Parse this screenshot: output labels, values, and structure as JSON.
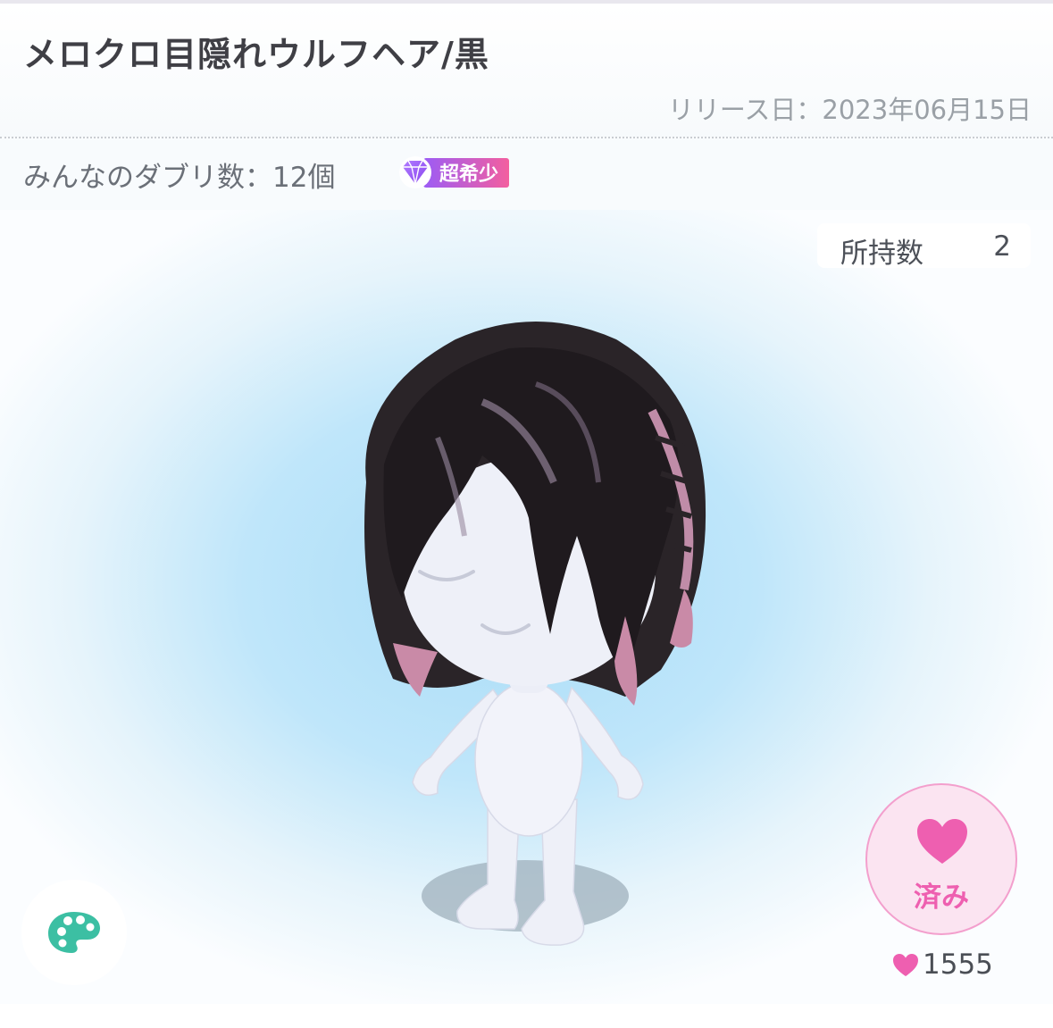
{
  "item": {
    "title": "メロクロ目隠れウルフヘア/黒",
    "release": "リリース日：2023年06月15日"
  },
  "stats": {
    "duplicates": "みんなのダブリ数：12個",
    "rarity_icon": "diamond-icon",
    "rarity_label": "超希少"
  },
  "owned": {
    "label": "所持数",
    "value": "2"
  },
  "actions": {
    "palette_icon": "palette-icon",
    "like_icon": "heart-icon",
    "like_label": "済み",
    "like_count": "1555"
  },
  "colors": {
    "accent_pink": "#ee5fb0",
    "rarity_gradient_start": "#9c5cf5",
    "rarity_gradient_end": "#f35f9f",
    "palette_teal": "#3cbfa3"
  }
}
